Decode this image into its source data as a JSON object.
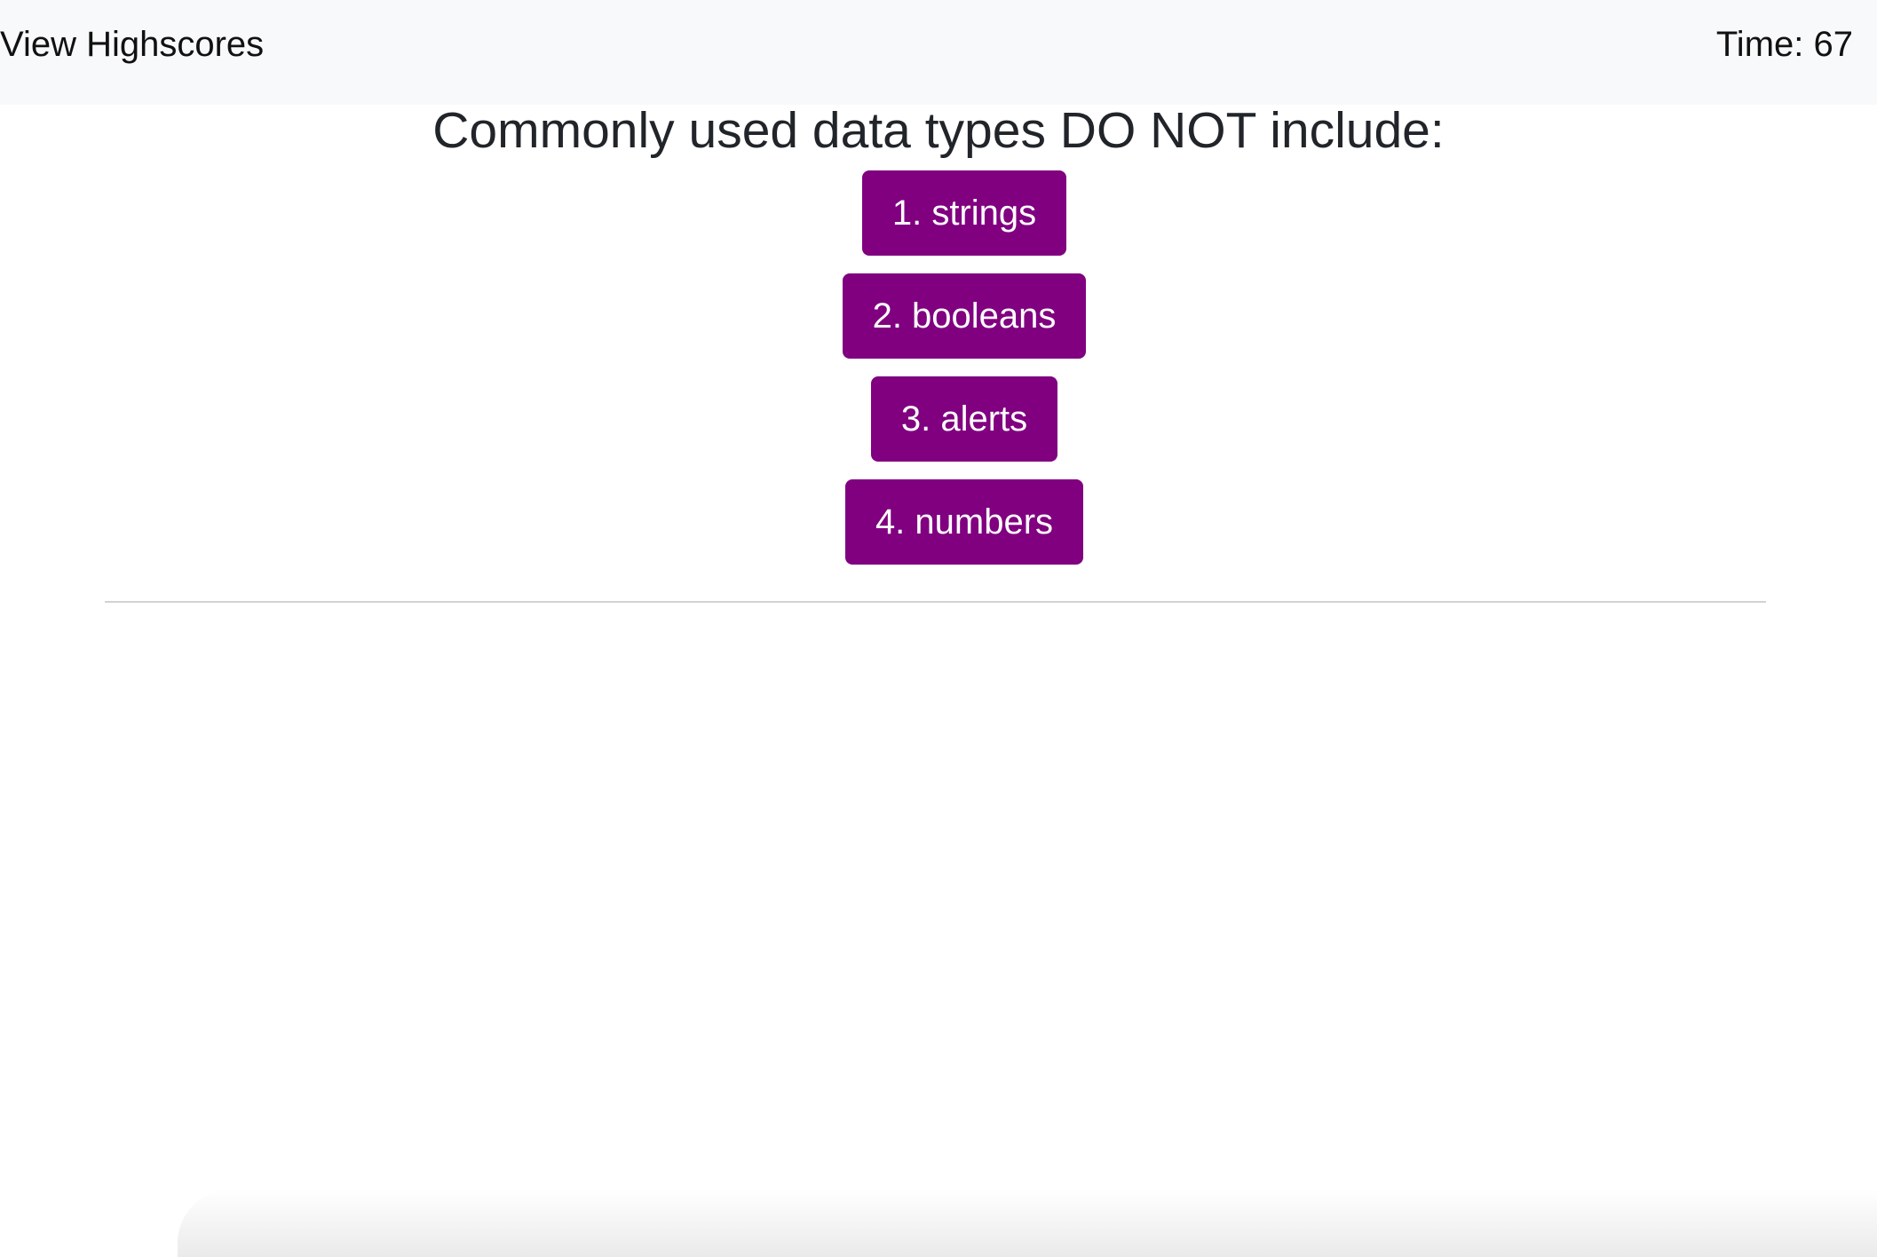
{
  "header": {
    "highscores_label": "View Highscores",
    "timer_label": "Time:",
    "timer_value": "67"
  },
  "quiz": {
    "question": "Commonly used data types DO NOT include:",
    "choices": [
      {
        "label": "1. strings"
      },
      {
        "label": "2. booleans"
      },
      {
        "label": "3. alerts"
      },
      {
        "label": "4. numbers"
      }
    ]
  },
  "colors": {
    "header_background": "#f8f9fa",
    "choice_button": "#800080",
    "choice_text": "#ffffff",
    "question_text": "#212529"
  }
}
